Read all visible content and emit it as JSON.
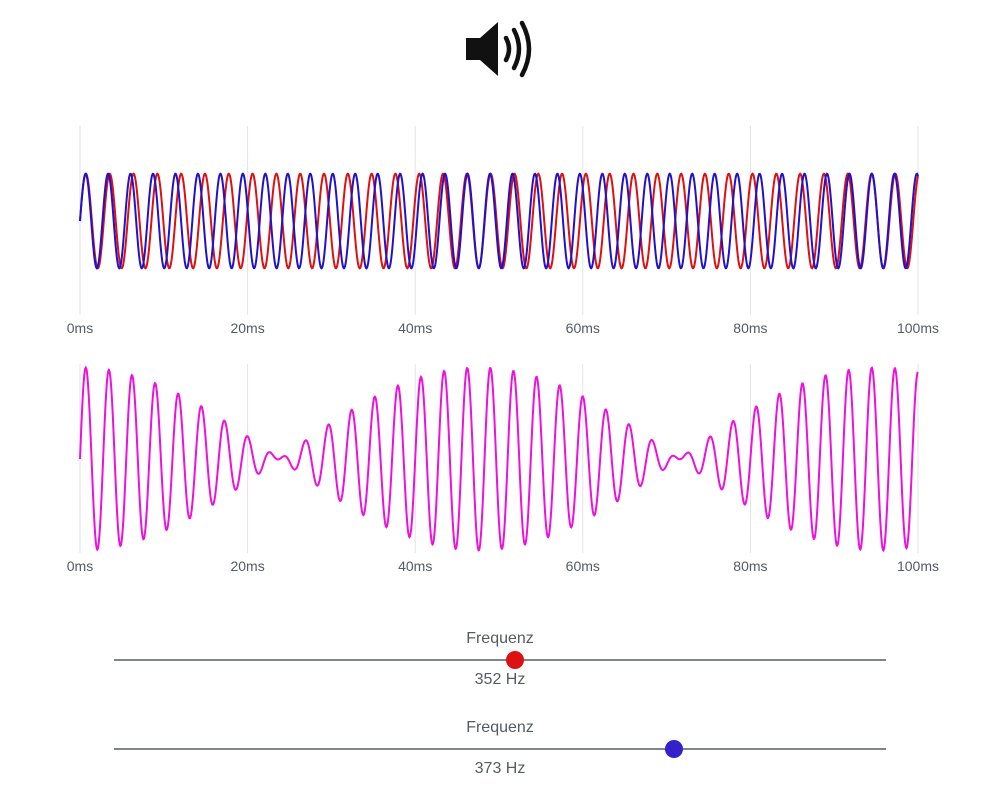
{
  "speaker": {
    "icon": "speaker-volume-icon"
  },
  "time_axis": {
    "ticks": [
      "0ms",
      "20ms",
      "40ms",
      "60ms",
      "80ms",
      "100ms"
    ]
  },
  "chart_data": [
    {
      "type": "line",
      "x_domain_ms": [
        0,
        100
      ],
      "ylim": [
        -1.1,
        1.1
      ],
      "grid": true,
      "series": [
        {
          "frequency_hz": 352,
          "amplitude": 1,
          "color": "#dd1111"
        },
        {
          "frequency_hz": 373,
          "amplitude": 1,
          "color": "#2211cc"
        }
      ]
    },
    {
      "type": "line",
      "x_domain_ms": [
        0,
        100
      ],
      "ylim": [
        -2.1,
        2.1
      ],
      "grid": true,
      "series": [
        {
          "sum_of_frequencies_hz": [
            352,
            373
          ],
          "color": "#ee11dd"
        }
      ]
    }
  ],
  "sliders": [
    {
      "title": "Frequenz",
      "value_label": "352 Hz",
      "value_hz": 352,
      "level": 0.519,
      "color": "#dd1111"
    },
    {
      "title": "Frequenz",
      "value_label": "373 Hz",
      "value_hz": 373,
      "level": 0.725,
      "color": "#3322cc"
    }
  ]
}
